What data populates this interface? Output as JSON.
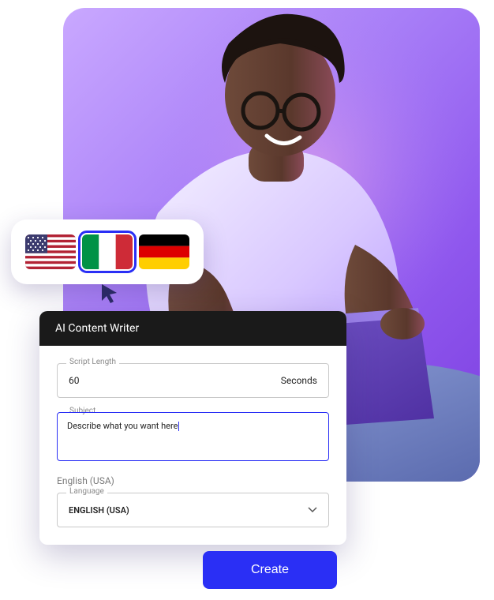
{
  "flags": {
    "items": [
      "us",
      "it",
      "de"
    ],
    "selected": "it"
  },
  "panel": {
    "title": "AI Content Writer",
    "script_length": {
      "label": "Script Length",
      "value": "60",
      "unit": "Seconds"
    },
    "subject": {
      "label": "Subject",
      "placeholder": "Describe what you want here"
    },
    "language_group": "English (USA)",
    "language": {
      "label": "Language",
      "value": "ENGLISH (USA)"
    }
  },
  "create_label": "Create"
}
